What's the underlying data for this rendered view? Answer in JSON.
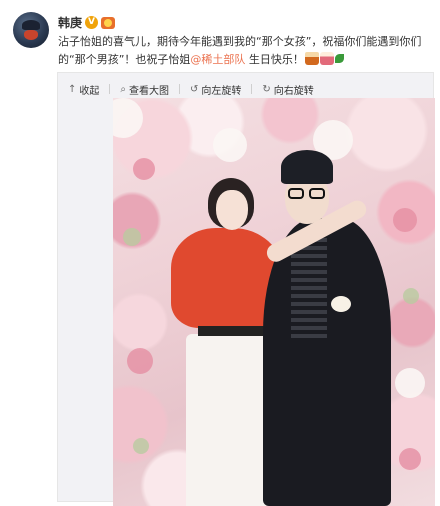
{
  "post": {
    "username": "韩庚",
    "text_part1": "沾子怡姐的喜气儿，期待今年能遇到我的“那个女孩”，祝福你们能遇到你们的“那个男孩”！也祝子怡姐",
    "mention": "@稀土部队",
    "text_part2": " 生日快乐！"
  },
  "toolbar": {
    "collapse_label": "收起",
    "view_large_label": "查看大图",
    "rotate_left_label": "向左旋转",
    "rotate_right_label": "向右旋转"
  },
  "icons": {
    "collapse": "arrow-up-icon",
    "view_large": "magnifier-icon",
    "rotate_left": "rotate-left-icon",
    "rotate_right": "rotate-right-icon"
  },
  "colors": {
    "mention": "#eb7350",
    "badge": "#f0a30a"
  }
}
